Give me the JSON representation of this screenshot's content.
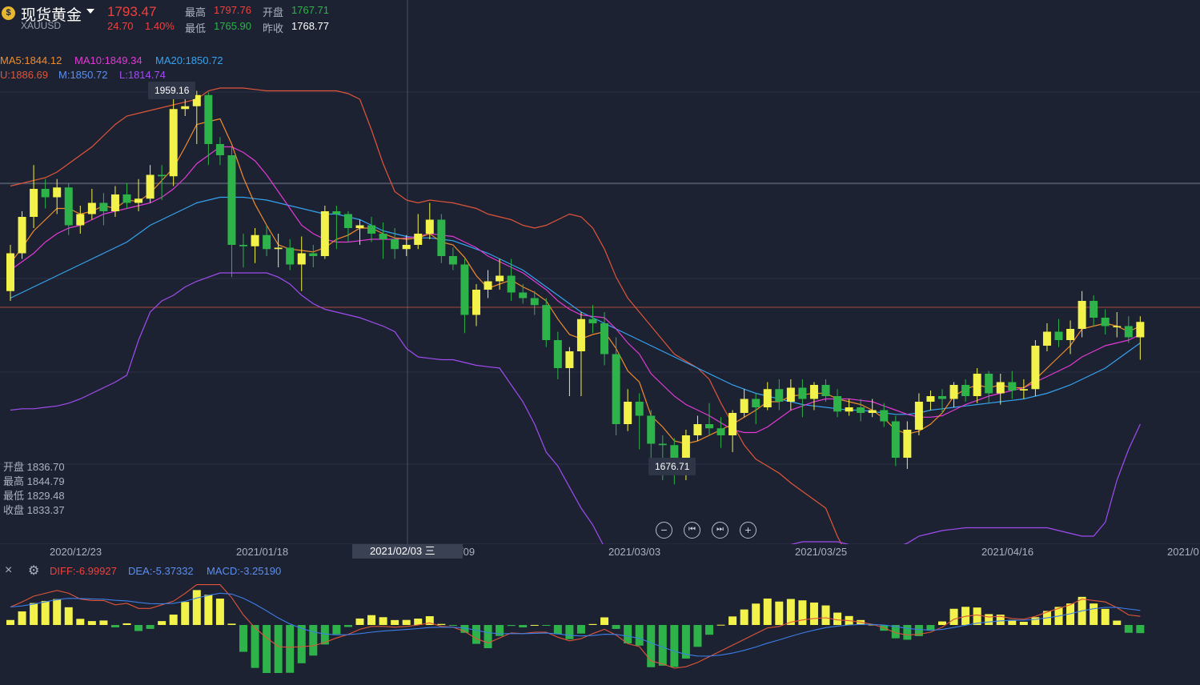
{
  "header": {
    "coin_icon": "coin-icon",
    "title": "现货黄金",
    "symbol": "XAUUSD",
    "price": "1793.47",
    "change": "24.70",
    "change_pct": "1.40%",
    "high_label": "最高",
    "high_value": "1797.76",
    "open_label": "开盘",
    "open_value": "1767.71",
    "low_label": "最低",
    "low_value": "1765.90",
    "prev_label": "昨收",
    "prev_value": "1768.77"
  },
  "indicators": {
    "ma5": "MA5:1844.12",
    "ma10": "MA10:1849.34",
    "ma20": "MA20:1850.72",
    "boll_u": "U:1886.69",
    "boll_m": "M:1850.72",
    "boll_l": "L:1814.74"
  },
  "hover_ohlc": {
    "open": "开盘 1836.70",
    "high": "最高 1844.79",
    "low": "最低 1829.48",
    "close": "收盘 1833.37"
  },
  "tooltips": {
    "max": "1959.16",
    "min": "1676.71"
  },
  "controls": {
    "zoom_out": "−",
    "prev": "⏮",
    "next": "⏭",
    "zoom_in": "+"
  },
  "axis_dates": [
    "2020/12/23",
    "2021/01/18",
    "2021/02/09",
    "2021/03/03",
    "2021/03/25",
    "2021/04/16",
    "2021/0"
  ],
  "crosshair_date": "2021/02/03 三",
  "macd": {
    "close_icon": "×",
    "settings_icon": "⚙",
    "diff": "DIFF:-6.99927",
    "dea": "DEA:-5.37332",
    "macd": "MACD:-3.25190"
  },
  "colors": {
    "up": "#f2f24a",
    "down": "#2db34a",
    "ma5": "#f08c2c",
    "ma10": "#e33ad6",
    "ma20": "#36a3f0",
    "boll_u": "#e0553a",
    "boll_m": "#36a3f0",
    "boll_l": "#a04cf0",
    "bg": "#1c2232"
  },
  "chart_data": {
    "type": "candlestick",
    "ylim": [
      1640,
      2000
    ],
    "candles": [
      [
        1815,
        1842,
        1848,
        1808
      ],
      [
        1842,
        1868,
        1872,
        1838
      ],
      [
        1868,
        1888,
        1905,
        1860
      ],
      [
        1888,
        1882,
        1895,
        1874
      ],
      [
        1882,
        1889,
        1895,
        1870
      ],
      [
        1889,
        1862,
        1892,
        1855
      ],
      [
        1862,
        1870,
        1876,
        1856
      ],
      [
        1870,
        1878,
        1888,
        1866
      ],
      [
        1878,
        1872,
        1885,
        1862
      ],
      [
        1872,
        1884,
        1890,
        1868
      ],
      [
        1884,
        1878,
        1892,
        1874
      ],
      [
        1878,
        1881,
        1895,
        1872
      ],
      [
        1881,
        1898,
        1905,
        1878
      ],
      [
        1898,
        1897,
        1905,
        1880
      ],
      [
        1897,
        1945,
        1952,
        1890
      ],
      [
        1945,
        1947,
        1959,
        1940
      ],
      [
        1947,
        1955,
        1958,
        1920
      ],
      [
        1955,
        1920,
        1957,
        1905
      ],
      [
        1920,
        1912,
        1925,
        1905
      ],
      [
        1912,
        1848,
        1918,
        1825
      ],
      [
        1848,
        1847,
        1856,
        1832
      ],
      [
        1847,
        1855,
        1860,
        1835
      ],
      [
        1855,
        1845,
        1862,
        1840
      ],
      [
        1845,
        1846,
        1856,
        1832
      ],
      [
        1846,
        1834,
        1852,
        1830
      ],
      [
        1834,
        1842,
        1854,
        1815
      ],
      [
        1842,
        1840,
        1848,
        1832
      ],
      [
        1840,
        1872,
        1876,
        1838
      ],
      [
        1872,
        1870,
        1876,
        1845
      ],
      [
        1870,
        1860,
        1872,
        1850
      ],
      [
        1860,
        1862,
        1866,
        1848
      ],
      [
        1862,
        1856,
        1868,
        1850
      ],
      [
        1856,
        1852,
        1864,
        1838
      ],
      [
        1852,
        1845,
        1860,
        1838
      ],
      [
        1845,
        1848,
        1855,
        1840
      ],
      [
        1848,
        1856,
        1870,
        1845
      ],
      [
        1856,
        1866,
        1878,
        1852
      ],
      [
        1866,
        1840,
        1870,
        1835
      ],
      [
        1840,
        1834,
        1846,
        1830
      ],
      [
        1834,
        1798,
        1838,
        1785
      ],
      [
        1798,
        1816,
        1820,
        1790
      ],
      [
        1816,
        1822,
        1830,
        1810
      ],
      [
        1822,
        1826,
        1838,
        1816
      ],
      [
        1826,
        1814,
        1838,
        1808
      ],
      [
        1814,
        1810,
        1820,
        1806
      ],
      [
        1810,
        1805,
        1815,
        1798
      ],
      [
        1805,
        1780,
        1810,
        1775
      ],
      [
        1780,
        1760,
        1786,
        1752
      ],
      [
        1760,
        1772,
        1775,
        1740
      ],
      [
        1772,
        1795,
        1800,
        1740
      ],
      [
        1795,
        1792,
        1805,
        1785
      ],
      [
        1792,
        1770,
        1800,
        1762
      ],
      [
        1770,
        1720,
        1782,
        1712
      ],
      [
        1720,
        1736,
        1745,
        1715
      ],
      [
        1736,
        1726,
        1742,
        1702
      ],
      [
        1726,
        1706,
        1730,
        1690
      ],
      [
        1706,
        1705,
        1712,
        1680
      ],
      [
        1705,
        1685,
        1710,
        1677
      ],
      [
        1685,
        1712,
        1716,
        1680
      ],
      [
        1712,
        1720,
        1726,
        1708
      ],
      [
        1720,
        1717,
        1735,
        1712
      ],
      [
        1717,
        1712,
        1725,
        1703
      ],
      [
        1712,
        1728,
        1730,
        1700
      ],
      [
        1728,
        1738,
        1745,
        1725
      ],
      [
        1738,
        1732,
        1742,
        1720
      ],
      [
        1732,
        1745,
        1750,
        1730
      ],
      [
        1745,
        1736,
        1752,
        1730
      ],
      [
        1736,
        1746,
        1752,
        1730
      ],
      [
        1746,
        1738,
        1752,
        1725
      ],
      [
        1738,
        1748,
        1750,
        1730
      ],
      [
        1748,
        1740,
        1752,
        1736
      ],
      [
        1740,
        1729,
        1745,
        1725
      ],
      [
        1729,
        1732,
        1738,
        1726
      ],
      [
        1732,
        1728,
        1738,
        1722
      ],
      [
        1728,
        1730,
        1738,
        1725
      ],
      [
        1730,
        1722,
        1735,
        1718
      ],
      [
        1722,
        1696,
        1726,
        1690
      ],
      [
        1696,
        1716,
        1722,
        1688
      ],
      [
        1716,
        1736,
        1742,
        1712
      ],
      [
        1736,
        1740,
        1744,
        1730
      ],
      [
        1740,
        1738,
        1745,
        1728
      ],
      [
        1738,
        1748,
        1750,
        1732
      ],
      [
        1748,
        1740,
        1752,
        1736
      ],
      [
        1740,
        1756,
        1760,
        1735
      ],
      [
        1756,
        1742,
        1758,
        1735
      ],
      [
        1742,
        1750,
        1756,
        1734
      ],
      [
        1750,
        1744,
        1758,
        1738
      ],
      [
        1744,
        1745,
        1752,
        1738
      ],
      [
        1745,
        1776,
        1780,
        1740
      ],
      [
        1776,
        1786,
        1792,
        1772
      ],
      [
        1786,
        1780,
        1795,
        1775
      ],
      [
        1780,
        1788,
        1794,
        1770
      ],
      [
        1788,
        1808,
        1815,
        1782
      ],
      [
        1808,
        1796,
        1812,
        1790
      ],
      [
        1796,
        1790,
        1802,
        1784
      ],
      [
        1790,
        1790,
        1800,
        1782
      ],
      [
        1790,
        1782,
        1797,
        1778
      ],
      [
        1782,
        1793,
        1797,
        1766
      ]
    ],
    "ma5": [
      1835,
      1846,
      1858,
      1866,
      1874,
      1874,
      1870,
      1872,
      1876,
      1874,
      1880,
      1879,
      1885,
      1894,
      1903,
      1918,
      1934,
      1936,
      1938,
      1920,
      1896,
      1877,
      1862,
      1848,
      1845,
      1844,
      1843,
      1846,
      1852,
      1855,
      1860,
      1860,
      1856,
      1853,
      1852,
      1853,
      1856,
      1850,
      1848,
      1839,
      1826,
      1817,
      1820,
      1823,
      1818,
      1814,
      1808,
      1795,
      1784,
      1781,
      1784,
      1786,
      1774,
      1758,
      1750,
      1726,
      1718,
      1708,
      1706,
      1708,
      1712,
      1716,
      1720,
      1725,
      1730,
      1736,
      1736,
      1740,
      1741,
      1742,
      1742,
      1738,
      1736,
      1734,
      1730,
      1724,
      1716,
      1713,
      1715,
      1720,
      1728,
      1740,
      1745,
      1748,
      1746,
      1748,
      1746,
      1746,
      1752,
      1760,
      1768,
      1776,
      1788,
      1790,
      1792,
      1790,
      1786,
      1790
    ],
    "ma10": [
      1830,
      1836,
      1842,
      1850,
      1856,
      1860,
      1862,
      1866,
      1870,
      1872,
      1874,
      1876,
      1878,
      1882,
      1888,
      1896,
      1906,
      1912,
      1918,
      1918,
      1914,
      1908,
      1898,
      1886,
      1874,
      1862,
      1856,
      1852,
      1850,
      1850,
      1851,
      1852,
      1852,
      1852,
      1853,
      1854,
      1856,
      1855,
      1854,
      1850,
      1846,
      1840,
      1836,
      1832,
      1828,
      1822,
      1816,
      1808,
      1802,
      1798,
      1797,
      1796,
      1788,
      1778,
      1770,
      1756,
      1748,
      1740,
      1734,
      1730,
      1726,
      1721,
      1716,
      1714,
      1714,
      1718,
      1724,
      1730,
      1733,
      1736,
      1738,
      1738,
      1738,
      1737,
      1736,
      1733,
      1730,
      1727,
      1725,
      1725,
      1726,
      1730,
      1734,
      1737,
      1740,
      1742,
      1744,
      1746,
      1750,
      1754,
      1758,
      1762,
      1768,
      1772,
      1776,
      1778,
      1780,
      1784
    ],
    "ma20": [
      1810,
      1814,
      1818,
      1822,
      1826,
      1830,
      1834,
      1838,
      1842,
      1846,
      1850,
      1856,
      1862,
      1866,
      1870,
      1874,
      1878,
      1880,
      1882,
      1882,
      1882,
      1881,
      1880,
      1878,
      1876,
      1874,
      1872,
      1870,
      1870,
      1868,
      1866,
      1862,
      1858,
      1856,
      1854,
      1853,
      1853,
      1852,
      1851,
      1848,
      1845,
      1842,
      1838,
      1834,
      1830,
      1824,
      1818,
      1812,
      1806,
      1800,
      1796,
      1792,
      1788,
      1784,
      1780,
      1776,
      1772,
      1768,
      1764,
      1760,
      1756,
      1752,
      1748,
      1745,
      1742,
      1740,
      1738,
      1736,
      1734,
      1733,
      1732,
      1731,
      1730,
      1730,
      1729,
      1728,
      1727,
      1727,
      1728,
      1730,
      1731,
      1732,
      1733,
      1734,
      1735,
      1736,
      1737,
      1738,
      1740,
      1742,
      1745,
      1748,
      1752,
      1756,
      1760,
      1766,
      1772,
      1778
    ],
    "boll_u": [
      1890,
      1892,
      1894,
      1896,
      1900,
      1906,
      1912,
      1918,
      1926,
      1934,
      1940,
      1942,
      1944,
      1946,
      1948,
      1950,
      1952,
      1958,
      1960,
      1960,
      1960,
      1959,
      1958,
      1958,
      1958,
      1958,
      1958,
      1958,
      1958,
      1956,
      1952,
      1930,
      1906,
      1886,
      1880,
      1878,
      1880,
      1879,
      1878,
      1876,
      1874,
      1870,
      1868,
      1866,
      1862,
      1860,
      1862,
      1866,
      1870,
      1868,
      1860,
      1845,
      1825,
      1810,
      1800,
      1790,
      1780,
      1770,
      1765,
      1760,
      1752,
      1735,
      1720,
      1705,
      1695,
      1690,
      1685,
      1678,
      1672,
      1666,
      1660,
      1640,
      1624,
      1610,
      1600,
      1592,
      1586,
      1586,
      1586,
      1586,
      1586,
      1586,
      1586,
      1585,
      1584,
      1586,
      1588,
      1592,
      1598,
      1602,
      1605,
      1610,
      1616,
      1620,
      1622,
      1622,
      1622,
      1624
    ],
    "boll_l": [
      1730,
      1731,
      1731,
      1732,
      1733,
      1735,
      1738,
      1742,
      1746,
      1750,
      1755,
      1780,
      1800,
      1808,
      1812,
      1818,
      1822,
      1825,
      1828,
      1828,
      1828,
      1828,
      1828,
      1825,
      1820,
      1812,
      1806,
      1802,
      1800,
      1798,
      1796,
      1793,
      1790,
      1786,
      1774,
      1768,
      1767,
      1766,
      1766,
      1764,
      1762,
      1761,
      1760,
      1748,
      1736,
      1720,
      1700,
      1690,
      1675,
      1660,
      1648,
      1632,
      1624,
      1620,
      1618,
      1616,
      1614,
      1612,
      1610,
      1610,
      1610,
      1610,
      1610,
      1614,
      1620,
      1624,
      1630,
      1634,
      1636,
      1636,
      1636,
      1636,
      1634,
      1632,
      1630,
      1630,
      1632,
      1635,
      1640,
      1642,
      1644,
      1645,
      1646,
      1646,
      1646,
      1646,
      1646,
      1646,
      1646,
      1646,
      1644,
      1642,
      1640,
      1640,
      1650,
      1680,
      1702,
      1720
    ]
  }
}
